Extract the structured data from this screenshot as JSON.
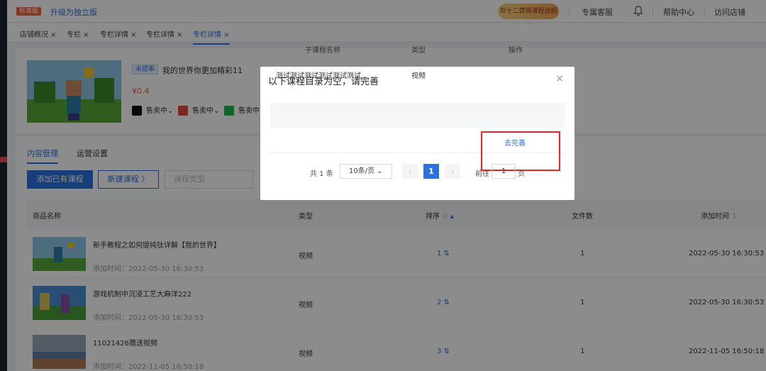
{
  "topbar": {
    "badge": "标准版",
    "upgrade_link": "升级为独立版",
    "promo": "双十二营销课程送超值",
    "nav": [
      "专属客服",
      "帮助中心",
      "访问店铺"
    ]
  },
  "tabs": [
    "店铺概况",
    "专栏",
    "专栏详情",
    "专栏详情",
    "专栏详情"
  ],
  "product": {
    "status": "未提审",
    "title": "我的世界你更加精彩11",
    "price": "¥0.4",
    "platforms": [
      {
        "label": "售卖中",
        "color": "#111111"
      },
      {
        "label": "售卖中",
        "color": "#e8463a"
      },
      {
        "label": "售卖中",
        "color": "#1fb451"
      }
    ]
  },
  "content_tabs": [
    "内容管理",
    "运营设置"
  ],
  "toolbar": {
    "add_existing": "添加已有课程",
    "new_course": "新建课程 〉",
    "type_placeholder": "课程类型"
  },
  "table": {
    "headers": [
      "商品名称",
      "类型",
      "排序",
      "文件数",
      "添加时间"
    ],
    "rows": [
      {
        "name": "新手教程之如何提纯钛详解【我的世界】",
        "added_label": "添加时间：2022-05-30 16:30:53",
        "type": "视频",
        "order": "1",
        "files": "1",
        "time": "2022-05-30 16:30:53"
      },
      {
        "name": "游戏机制中沉浸工艺大麻洋222",
        "added_label": "添加时间：2022-05-30 16:30:53",
        "type": "视频",
        "order": "2",
        "files": "1",
        "time": "2022-05-30 16:30:53"
      },
      {
        "name": "11021426赠送视频",
        "added_label": "添加时间：2022-11-05 16:50:18",
        "type": "视频",
        "order": "3",
        "files": "1",
        "time": "2022-11-05 16:50:18"
      }
    ]
  },
  "modal": {
    "title": "以下课程目录为空，请完善",
    "close": "×",
    "headers": [
      "子课程名称",
      "类型",
      "操作"
    ],
    "row": {
      "name": "测试测试测试测试测试测试",
      "type": "视频",
      "action": "去完善"
    },
    "pagination": {
      "total": "共 1 条",
      "page_size": "10条/页",
      "prev": "‹",
      "current": "1",
      "next": "›",
      "goto_prefix": "前往",
      "goto_value": "1",
      "goto_suffix": "页"
    }
  },
  "colors": {
    "accent": "#2a72de",
    "highlight": "#e8271f",
    "price": "#f05a3a"
  }
}
